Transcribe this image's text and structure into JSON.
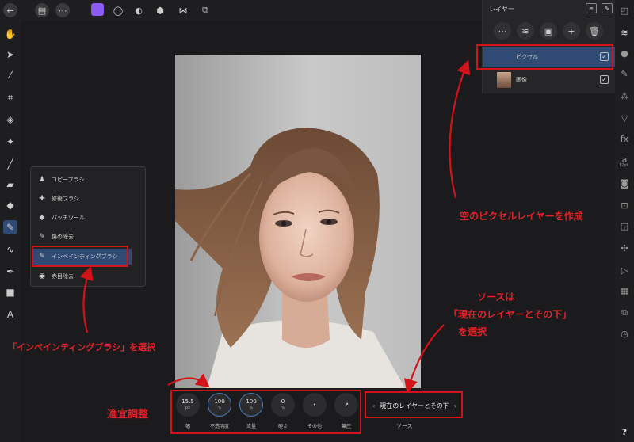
{
  "layers_panel": {
    "title": "レイヤー",
    "layers": [
      {
        "name": "ピクセル",
        "checked": true
      },
      {
        "name": "画像",
        "checked": true
      }
    ]
  },
  "popup_menu": {
    "items": [
      {
        "label": "コピーブラシ",
        "icon": "clone-brush-icon"
      },
      {
        "label": "修復ブラシ",
        "icon": "healing-brush-icon"
      },
      {
        "label": "パッチツール",
        "icon": "patch-tool-icon"
      },
      {
        "label": "傷の除去",
        "icon": "blemish-removal-icon"
      },
      {
        "label": "インペインティングブラシ",
        "icon": "inpainting-brush-icon",
        "selected": true
      },
      {
        "label": "赤目除去",
        "icon": "red-eye-icon"
      }
    ]
  },
  "context_toolbar": {
    "controls": [
      {
        "value": "15.5",
        "unit": "px",
        "label": "幅"
      },
      {
        "value": "100",
        "unit": "%",
        "label": "不透明度"
      },
      {
        "value": "100",
        "unit": "%",
        "label": "流量"
      },
      {
        "value": "0",
        "unit": "%",
        "label": "硬さ"
      },
      {
        "value": "•",
        "unit": "",
        "label": "その他"
      },
      {
        "value": "↗",
        "unit": "",
        "label": "筆圧"
      }
    ],
    "source": {
      "value": "現在のレイヤーとその下",
      "label": "ソース"
    }
  },
  "right_toolbar": {
    "font_size_label": "12pt"
  },
  "help_label": "?",
  "annotations": {
    "create_layer": "空のピクセルレイヤーを作成",
    "select_inpainting": "「インペインティングブラシ」を選択",
    "adjust": "適宜調整",
    "source_line1": "ソースは",
    "source_line2": "「現在のレイヤーとその下」",
    "source_line3": "を選択"
  },
  "colors": {
    "annotation_red": "#d3131a",
    "persona_purple": "#8a5cf5",
    "selection_blue": "#2f4a73"
  }
}
